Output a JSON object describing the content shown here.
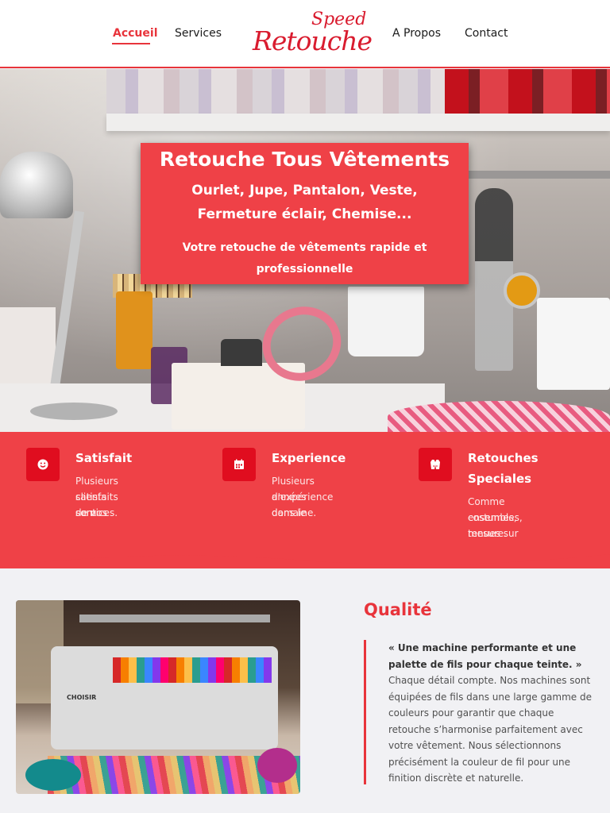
{
  "nav": {
    "items": [
      {
        "label": "Accueil",
        "active": true
      },
      {
        "label": "Services",
        "active": false
      },
      {
        "label": "A Propos",
        "active": false
      },
      {
        "label": "Contact",
        "active": false
      }
    ],
    "logo": {
      "top": "Speed",
      "main": "Retouche"
    }
  },
  "hero": {
    "title": "Retouche Tous Vêtements",
    "subtitle_line1": "Ourlet, Jupe, Pantalon, Veste,",
    "subtitle_line2": "Fermeture éclair, Chemise...",
    "tagline_line1": "Votre retouche de vêtements rapide et",
    "tagline_line2": "professionnelle"
  },
  "features": [
    {
      "icon": "smiley-icon",
      "title": "Satisfait",
      "lines": [
        "Plusieurs clients sont",
        "satisfaits de nos",
        "services."
      ]
    },
    {
      "icon": "calendar-icon",
      "title": "Experience",
      "lines": [
        "Plusieurs années",
        "d'expérience dans le",
        "domaine."
      ]
    },
    {
      "icon": "vest-icon",
      "title_lines": [
        "Retouches",
        "Speciales"
      ],
      "lines": [
        "Comme costumes,",
        "ensembles, tenues sur",
        "mesure."
      ]
    }
  ],
  "quality": {
    "title": "Qualité",
    "quote_line1": "« Une machine performante et une",
    "quote_line2": "palette de fils pour chaque teinte. »",
    "body_lines": [
      "Chaque détail compte. Nos machines sont",
      "équipées de fils dans une large gamme de",
      "couleurs pour garantir que chaque",
      "retouche s’harmonise parfaitement avec",
      "votre vêtement. Nous sélectionnons",
      "précisément la couleur de fil pour une",
      "finition discrète et naturelle."
    ],
    "photo_brand": "CHOISIR"
  },
  "colors": {
    "accent": "#e8343b",
    "feature_bg": "#ef4147",
    "icon_bg": "#e00d1f",
    "section_bg": "#f1f1f4"
  }
}
